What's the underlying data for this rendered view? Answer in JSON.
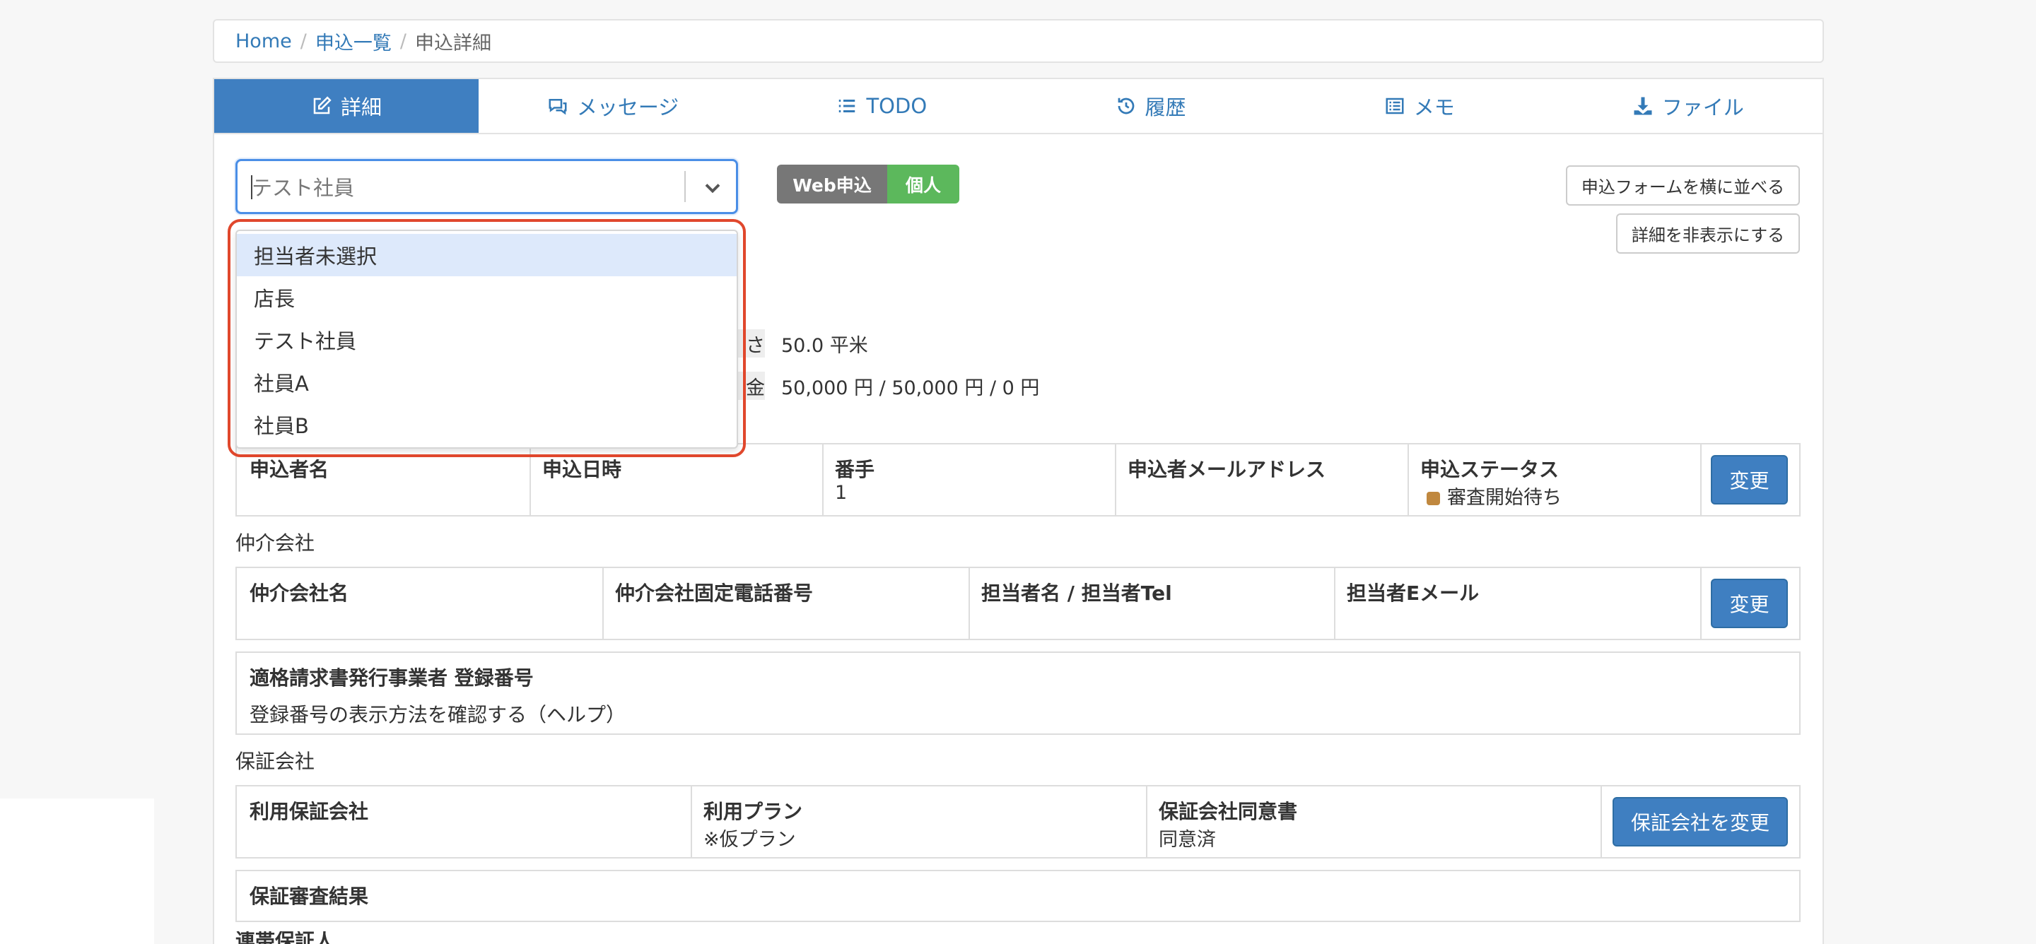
{
  "breadcrumb": {
    "home": "Home",
    "list": "申込一覧",
    "current": "申込詳細"
  },
  "tabs": [
    {
      "label": "詳細",
      "icon": "edit-icon"
    },
    {
      "label": "メッセージ",
      "icon": "comments-icon"
    },
    {
      "label": "TODO",
      "icon": "list-icon"
    },
    {
      "label": "履歴",
      "icon": "history-icon"
    },
    {
      "label": "メモ",
      "icon": "memo-icon"
    },
    {
      "label": "ファイル",
      "icon": "download-icon"
    }
  ],
  "assignee_select": {
    "value": "テスト社員",
    "options": [
      "担当者未選択",
      "店長",
      "テスト社員",
      "社員A",
      "社員B"
    ]
  },
  "badges": {
    "web": "Web申込",
    "individual": "個人"
  },
  "buttons": {
    "side_by_side": "申込フォームを横に並べる",
    "hide_details": "詳細を非表示にする",
    "change": "変更",
    "change_guarantor": "保証会社を変更"
  },
  "property": {
    "area_label_partial": "さ",
    "area": "50.0 平米",
    "money_label_partial": "金",
    "money": "50,000 円 / 50,000 円 / 0 円"
  },
  "applicant": {
    "headers": [
      "申込者名",
      "申込日時",
      "番手",
      "申込者メールアドレス",
      "申込ステータス"
    ],
    "rank": "1",
    "status": "審査開始待ち"
  },
  "broker": {
    "title": "仲介会社",
    "headers": [
      "仲介会社名",
      "仲介会社固定電話番号",
      "担当者名 / 担当者Tel",
      "担当者Eメール"
    ]
  },
  "invoice": {
    "title": "適格請求書発行事業者 登録番号",
    "help_link": "登録番号の表示方法を確認する（ヘルプ）"
  },
  "guarantor": {
    "title": "保証会社",
    "headers": [
      "利用保証会社",
      "利用プラン",
      "保証会社同意書"
    ],
    "plan": "※仮プラン",
    "consent": "同意済",
    "result_label": "保証審査結果",
    "next_partial": "連帯保証人"
  },
  "colors": {
    "primary": "#3f7fc1",
    "badge_gray": "#777777",
    "badge_green": "#5cb85c",
    "highlight": "#e0472c",
    "status": "#c0883f"
  }
}
